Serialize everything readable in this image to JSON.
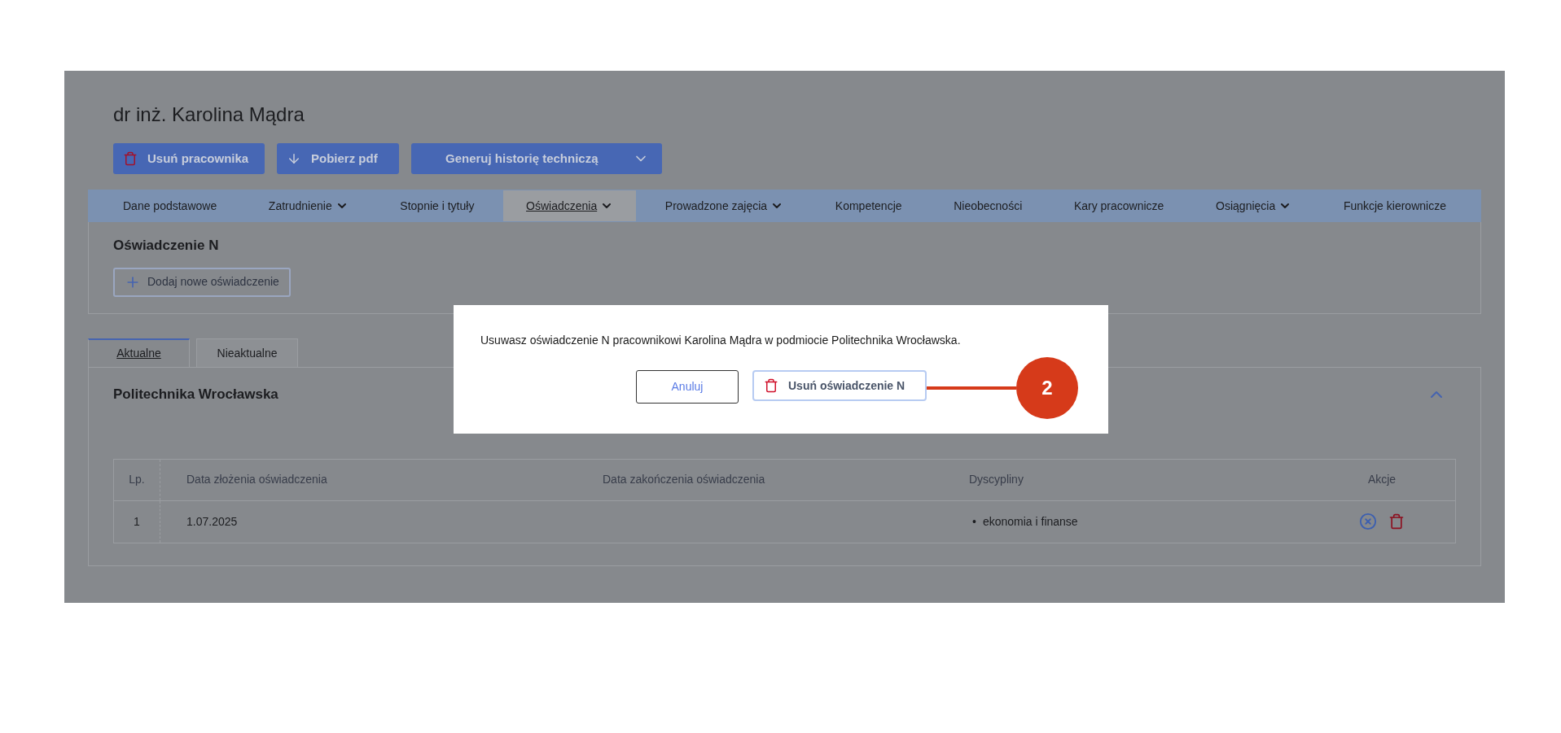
{
  "title": "dr inż. Karolina Mądra",
  "header_buttons": [
    {
      "label": "Usuń pracownika",
      "kind": "delete"
    },
    {
      "label": "Pobierz pdf",
      "kind": "download"
    },
    {
      "label": "Generuj historię techniczą",
      "kind": "dropdown"
    }
  ],
  "nav_tabs": [
    {
      "label": "Dane podstawowe",
      "selected": false,
      "dropdown": false
    },
    {
      "label": "Zatrudnienie",
      "selected": false,
      "dropdown": true
    },
    {
      "label": "Stopnie i tytuły",
      "selected": false,
      "dropdown": false
    },
    {
      "label": "Oświadczenia",
      "selected": true,
      "dropdown": true
    },
    {
      "label": "Prowadzone zajęcia",
      "selected": false,
      "dropdown": true
    },
    {
      "label": "Kompetencje",
      "selected": false,
      "dropdown": false
    },
    {
      "label": "Nieobecności",
      "selected": false,
      "dropdown": false
    },
    {
      "label": "Kary pracownicze",
      "selected": false,
      "dropdown": false
    },
    {
      "label": "Osiągnięcia",
      "selected": false,
      "dropdown": true
    },
    {
      "label": "Funkcje kierownicze",
      "selected": false,
      "dropdown": false
    }
  ],
  "section": {
    "title": "Oświadczenie N",
    "add_button": "Dodaj nowe oświadczenie"
  },
  "sub_tabs": [
    {
      "label": "Aktualne",
      "selected": true
    },
    {
      "label": "Nieaktualne",
      "selected": false
    }
  ],
  "panel": {
    "title": "Politechnika Wrocławska",
    "expanded": true
  },
  "table": {
    "columns": [
      "Lp.",
      "Data złożenia oświadczenia",
      "Data zakończenia oświadczenia",
      "Dyscypliny",
      "Akcje"
    ],
    "rows": [
      {
        "lp": "1",
        "date_submitted": "1.07.2025",
        "disciplines": [
          {
            "bullet": "•",
            "text": "ekonomia i finanse"
          }
        ]
      }
    ]
  },
  "dialog": {
    "message": "Usuwasz oświadczenie N pracownikowi Karolina Mądra w podmiocie Politechnika Wrocławska.",
    "cancel": "Anuluj",
    "confirm": "Usuń oświadczenie N"
  },
  "callout": {
    "number": "2"
  }
}
